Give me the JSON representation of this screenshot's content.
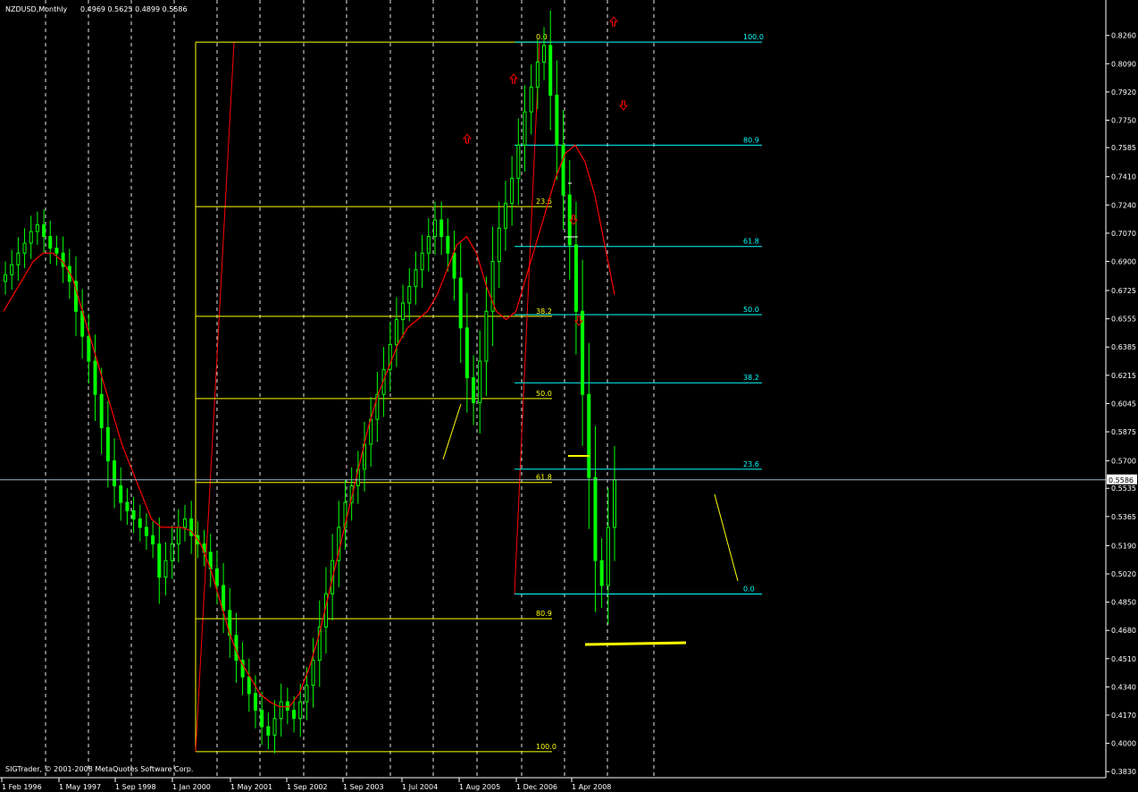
{
  "window": {
    "title": "NZDUSD,Monthly",
    "ohlc": "0.4969 0.5625 0.4899 0.5586",
    "copyright": "SIGTrader, © 2001-2008 MetaQuotes Software Corp."
  },
  "colors": {
    "background": "#000000",
    "candle": "#00ff00",
    "moving_average": "#ff0000",
    "fib_primary": "#ffff00",
    "fib_secondary": "#00ffff",
    "grid": "#ffffff",
    "price_line": "#9ab5c8"
  },
  "chart_data": {
    "type": "candlestick",
    "title": "NZDUSD,Monthly",
    "ylim": [
      0.3815,
      0.8285
    ],
    "y_ticks": [
      "0.8260",
      "0.8090",
      "0.7920",
      "0.7750",
      "0.7585",
      "0.7410",
      "0.7240",
      "0.7070",
      "0.6900",
      "0.6725",
      "0.6555",
      "0.6385",
      "0.6215",
      "0.6045",
      "0.5875",
      "0.5700",
      "0.5535",
      "0.5365",
      "0.5190",
      "0.5020",
      "0.4850",
      "0.4680",
      "0.4510",
      "0.4340",
      "0.4170",
      "0.4000",
      "0.3830"
    ],
    "x_ticks": [
      "1 Feb 1996",
      "1 May 1997",
      "1 Sep 1998",
      "1 Jan 2000",
      "1 May 2001",
      "1 Sep 2002",
      "1 Sep 2003",
      "1 Jul 2004",
      "1 Aug 2005",
      "1 Dec 2006",
      "1 Apr 2008"
    ],
    "grid": "vertical dashed",
    "current_price": "0.5586",
    "series": [
      {
        "name": "close (approx.)",
        "values": [
          0.682,
          0.688,
          0.695,
          0.701,
          0.708,
          0.712,
          0.705,
          0.698,
          0.695,
          0.687,
          0.678,
          0.66,
          0.645,
          0.63,
          0.61,
          0.59,
          0.57,
          0.555,
          0.545,
          0.54,
          0.535,
          0.53,
          0.525,
          0.52,
          0.5,
          0.51,
          0.52,
          0.53,
          0.535,
          0.525,
          0.52,
          0.515,
          0.505,
          0.495,
          0.48,
          0.465,
          0.45,
          0.44,
          0.43,
          0.42,
          0.41,
          0.405,
          0.415,
          0.425,
          0.42,
          0.415,
          0.425,
          0.435,
          0.45,
          0.47,
          0.49,
          0.51,
          0.53,
          0.545,
          0.555,
          0.565,
          0.58,
          0.595,
          0.61,
          0.625,
          0.64,
          0.655,
          0.665,
          0.675,
          0.685,
          0.695,
          0.705,
          0.715,
          0.705,
          0.695,
          0.68,
          0.65,
          0.62,
          0.605,
          0.63,
          0.66,
          0.69,
          0.71,
          0.725,
          0.74,
          0.76,
          0.78,
          0.795,
          0.81,
          0.82,
          0.79,
          0.76,
          0.73,
          0.7,
          0.66,
          0.61,
          0.56,
          0.51,
          0.495,
          0.53,
          0.5586
        ]
      },
      {
        "name": "moving average (approx.)",
        "values": [
          0.66,
          0.67,
          0.68,
          0.69,
          0.695,
          0.695,
          0.69,
          0.68,
          0.66,
          0.64,
          0.62,
          0.6,
          0.58,
          0.565,
          0.55,
          0.535,
          0.53,
          0.53,
          0.53,
          0.528,
          0.52,
          0.505,
          0.485,
          0.465,
          0.45,
          0.44,
          0.43,
          0.425,
          0.422,
          0.422,
          0.43,
          0.445,
          0.465,
          0.49,
          0.515,
          0.54,
          0.565,
          0.59,
          0.61,
          0.625,
          0.64,
          0.65,
          0.655,
          0.66,
          0.67,
          0.685,
          0.7,
          0.705,
          0.695,
          0.675,
          0.66,
          0.655,
          0.66,
          0.68,
          0.7,
          0.72,
          0.74,
          0.755,
          0.76,
          0.75,
          0.73,
          0.7,
          0.67
        ]
      }
    ],
    "fibonacci_primary": {
      "levels": [
        "0.0",
        "23.6",
        "38.2",
        "50.0",
        "61.8",
        "80.9",
        "100.0"
      ],
      "prices": [
        0.822,
        0.723,
        0.657,
        0.6075,
        0.557,
        0.475,
        0.395
      ]
    },
    "fibonacci_secondary": {
      "levels": [
        "100.0",
        "80.9",
        "61.8",
        "50.0",
        "38.2",
        "23.6",
        "0.0"
      ],
      "prices": [
        0.822,
        0.76,
        0.699,
        0.658,
        0.617,
        0.565,
        0.4899
      ]
    }
  }
}
